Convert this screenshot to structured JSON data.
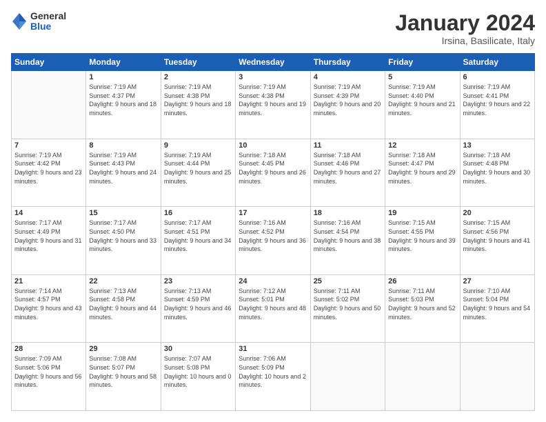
{
  "logo": {
    "general": "General",
    "blue": "Blue"
  },
  "header": {
    "month": "January 2024",
    "location": "Irsina, Basilicate, Italy"
  },
  "weekdays": [
    "Sunday",
    "Monday",
    "Tuesday",
    "Wednesday",
    "Thursday",
    "Friday",
    "Saturday"
  ],
  "days": [
    {
      "date": "",
      "sunrise": "",
      "sunset": "",
      "daylight": ""
    },
    {
      "date": "1",
      "sunrise": "Sunrise: 7:19 AM",
      "sunset": "Sunset: 4:37 PM",
      "daylight": "Daylight: 9 hours and 18 minutes."
    },
    {
      "date": "2",
      "sunrise": "Sunrise: 7:19 AM",
      "sunset": "Sunset: 4:38 PM",
      "daylight": "Daylight: 9 hours and 18 minutes."
    },
    {
      "date": "3",
      "sunrise": "Sunrise: 7:19 AM",
      "sunset": "Sunset: 4:38 PM",
      "daylight": "Daylight: 9 hours and 19 minutes."
    },
    {
      "date": "4",
      "sunrise": "Sunrise: 7:19 AM",
      "sunset": "Sunset: 4:39 PM",
      "daylight": "Daylight: 9 hours and 20 minutes."
    },
    {
      "date": "5",
      "sunrise": "Sunrise: 7:19 AM",
      "sunset": "Sunset: 4:40 PM",
      "daylight": "Daylight: 9 hours and 21 minutes."
    },
    {
      "date": "6",
      "sunrise": "Sunrise: 7:19 AM",
      "sunset": "Sunset: 4:41 PM",
      "daylight": "Daylight: 9 hours and 22 minutes."
    },
    {
      "date": "7",
      "sunrise": "Sunrise: 7:19 AM",
      "sunset": "Sunset: 4:42 PM",
      "daylight": "Daylight: 9 hours and 23 minutes."
    },
    {
      "date": "8",
      "sunrise": "Sunrise: 7:19 AM",
      "sunset": "Sunset: 4:43 PM",
      "daylight": "Daylight: 9 hours and 24 minutes."
    },
    {
      "date": "9",
      "sunrise": "Sunrise: 7:19 AM",
      "sunset": "Sunset: 4:44 PM",
      "daylight": "Daylight: 9 hours and 25 minutes."
    },
    {
      "date": "10",
      "sunrise": "Sunrise: 7:18 AM",
      "sunset": "Sunset: 4:45 PM",
      "daylight": "Daylight: 9 hours and 26 minutes."
    },
    {
      "date": "11",
      "sunrise": "Sunrise: 7:18 AM",
      "sunset": "Sunset: 4:46 PM",
      "daylight": "Daylight: 9 hours and 27 minutes."
    },
    {
      "date": "12",
      "sunrise": "Sunrise: 7:18 AM",
      "sunset": "Sunset: 4:47 PM",
      "daylight": "Daylight: 9 hours and 29 minutes."
    },
    {
      "date": "13",
      "sunrise": "Sunrise: 7:18 AM",
      "sunset": "Sunset: 4:48 PM",
      "daylight": "Daylight: 9 hours and 30 minutes."
    },
    {
      "date": "14",
      "sunrise": "Sunrise: 7:17 AM",
      "sunset": "Sunset: 4:49 PM",
      "daylight": "Daylight: 9 hours and 31 minutes."
    },
    {
      "date": "15",
      "sunrise": "Sunrise: 7:17 AM",
      "sunset": "Sunset: 4:50 PM",
      "daylight": "Daylight: 9 hours and 33 minutes."
    },
    {
      "date": "16",
      "sunrise": "Sunrise: 7:17 AM",
      "sunset": "Sunset: 4:51 PM",
      "daylight": "Daylight: 9 hours and 34 minutes."
    },
    {
      "date": "17",
      "sunrise": "Sunrise: 7:16 AM",
      "sunset": "Sunset: 4:52 PM",
      "daylight": "Daylight: 9 hours and 36 minutes."
    },
    {
      "date": "18",
      "sunrise": "Sunrise: 7:16 AM",
      "sunset": "Sunset: 4:54 PM",
      "daylight": "Daylight: 9 hours and 38 minutes."
    },
    {
      "date": "19",
      "sunrise": "Sunrise: 7:15 AM",
      "sunset": "Sunset: 4:55 PM",
      "daylight": "Daylight: 9 hours and 39 minutes."
    },
    {
      "date": "20",
      "sunrise": "Sunrise: 7:15 AM",
      "sunset": "Sunset: 4:56 PM",
      "daylight": "Daylight: 9 hours and 41 minutes."
    },
    {
      "date": "21",
      "sunrise": "Sunrise: 7:14 AM",
      "sunset": "Sunset: 4:57 PM",
      "daylight": "Daylight: 9 hours and 43 minutes."
    },
    {
      "date": "22",
      "sunrise": "Sunrise: 7:13 AM",
      "sunset": "Sunset: 4:58 PM",
      "daylight": "Daylight: 9 hours and 44 minutes."
    },
    {
      "date": "23",
      "sunrise": "Sunrise: 7:13 AM",
      "sunset": "Sunset: 4:59 PM",
      "daylight": "Daylight: 9 hours and 46 minutes."
    },
    {
      "date": "24",
      "sunrise": "Sunrise: 7:12 AM",
      "sunset": "Sunset: 5:01 PM",
      "daylight": "Daylight: 9 hours and 48 minutes."
    },
    {
      "date": "25",
      "sunrise": "Sunrise: 7:11 AM",
      "sunset": "Sunset: 5:02 PM",
      "daylight": "Daylight: 9 hours and 50 minutes."
    },
    {
      "date": "26",
      "sunrise": "Sunrise: 7:11 AM",
      "sunset": "Sunset: 5:03 PM",
      "daylight": "Daylight: 9 hours and 52 minutes."
    },
    {
      "date": "27",
      "sunrise": "Sunrise: 7:10 AM",
      "sunset": "Sunset: 5:04 PM",
      "daylight": "Daylight: 9 hours and 54 minutes."
    },
    {
      "date": "28",
      "sunrise": "Sunrise: 7:09 AM",
      "sunset": "Sunset: 5:06 PM",
      "daylight": "Daylight: 9 hours and 56 minutes."
    },
    {
      "date": "29",
      "sunrise": "Sunrise: 7:08 AM",
      "sunset": "Sunset: 5:07 PM",
      "daylight": "Daylight: 9 hours and 58 minutes."
    },
    {
      "date": "30",
      "sunrise": "Sunrise: 7:07 AM",
      "sunset": "Sunset: 5:08 PM",
      "daylight": "Daylight: 10 hours and 0 minutes."
    },
    {
      "date": "31",
      "sunrise": "Sunrise: 7:06 AM",
      "sunset": "Sunset: 5:09 PM",
      "daylight": "Daylight: 10 hours and 2 minutes."
    }
  ]
}
